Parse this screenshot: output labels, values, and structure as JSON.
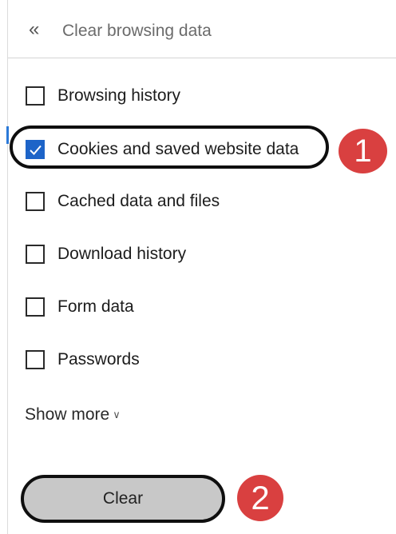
{
  "header": {
    "back_icon": "«",
    "title": "Clear browsing data"
  },
  "options": [
    {
      "label": "Browsing history",
      "checked": false
    },
    {
      "label": "Cookies and saved website data",
      "checked": true
    },
    {
      "label": "Cached data and files",
      "checked": false
    },
    {
      "label": "Download history",
      "checked": false
    },
    {
      "label": "Form data",
      "checked": false
    },
    {
      "label": "Passwords",
      "checked": false
    }
  ],
  "show_more": {
    "label": "Show more",
    "chevron": "∨"
  },
  "clear_button": {
    "label": "Clear"
  },
  "annotations": {
    "step1": "1",
    "step2": "2"
  },
  "colors": {
    "accent": "#1d64c8",
    "badge": "#d94040",
    "button_fill": "#c8c8c8"
  }
}
